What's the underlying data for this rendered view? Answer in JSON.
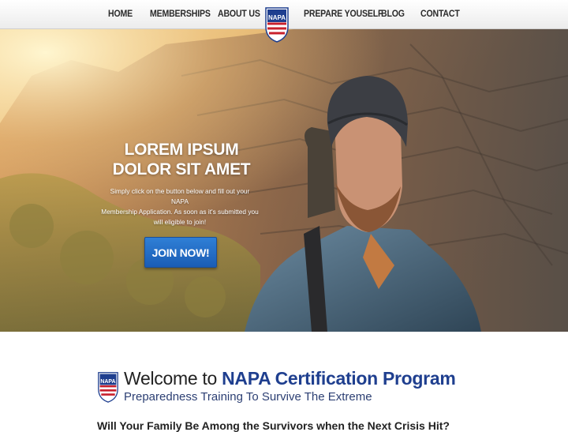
{
  "nav": {
    "items": [
      "HOME",
      "MEMBERSHIPS",
      "ABOUT US",
      "PREPARE YOUSELF",
      "BLOG",
      "CONTACT"
    ],
    "logo_text": "NAPA"
  },
  "hero": {
    "title_line1": "LOREM IPSUM",
    "title_line2": "DOLOR SIT AMET",
    "text_line1": "Simply click on the button below and fill out your NAPA",
    "text_line2": "Membership Application. As soon as it's submitted you",
    "text_line3": "will eligible to join!",
    "button_label": "JOIN NOW!"
  },
  "welcome": {
    "title_prefix": "Welcome to",
    "title_brand": "NAPA Certification Program",
    "subtitle": "Preparedness Training To Survive The Extreme",
    "logo_text": "NAPA",
    "cutoff_text": "Will Your Family Be Among the Survivors when the Next Crisis Hit?"
  },
  "colors": {
    "brand_blue": "#1f3f8f",
    "button_blue": "#2470c9",
    "flag_red": "#c8202c"
  }
}
